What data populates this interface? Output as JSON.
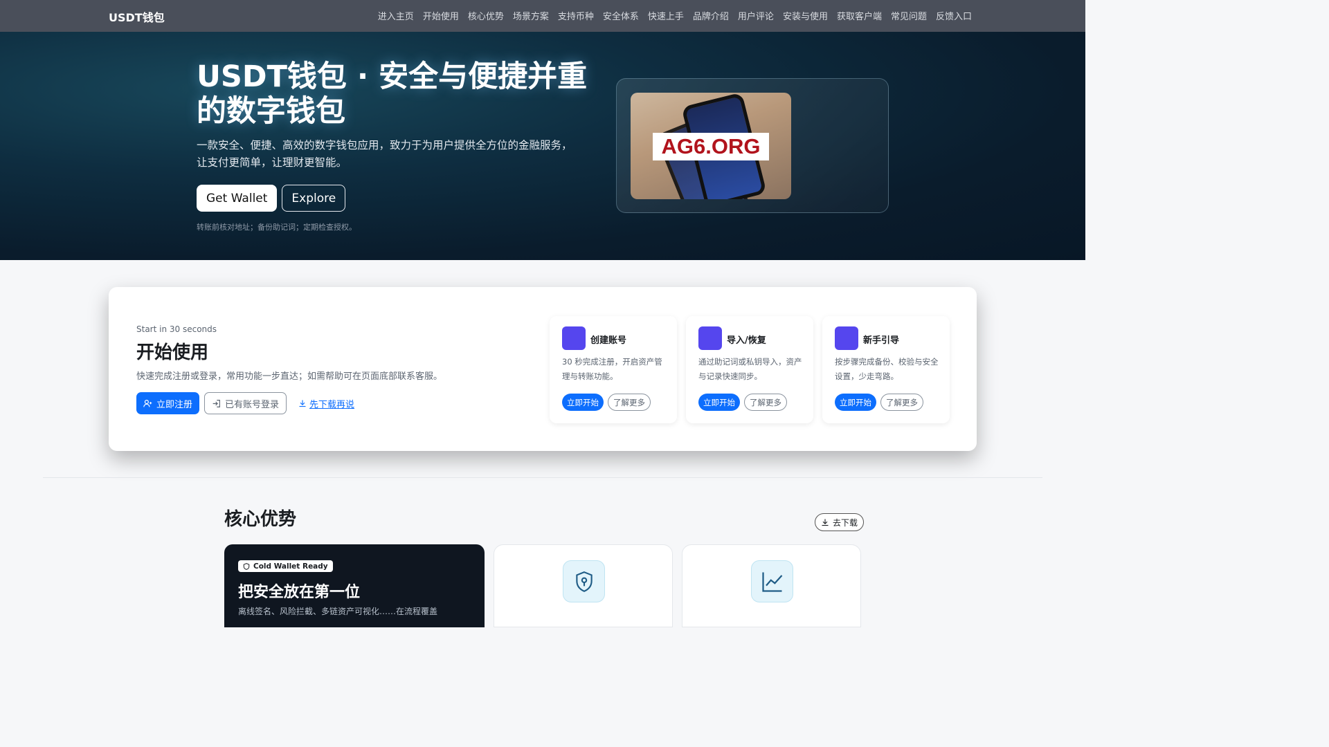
{
  "nav": {
    "brand": "USDT钱包",
    "links": [
      "进入主页",
      "开始使用",
      "核心优势",
      "场景方案",
      "支持币种",
      "安全体系",
      "快速上手",
      "品牌介绍",
      "用户评论",
      "安装与使用",
      "获取客户端",
      "常见问题",
      "反馈入口"
    ]
  },
  "hero": {
    "title": "USDT钱包 · 安全与便捷并重的数字钱包",
    "subtitle": "一款安全、便捷、高效的数字钱包应用，致力于为用户提供全方位的金融服务，让支付更简单，让理财更智能。",
    "btn_primary": "Get Wallet",
    "btn_secondary": "Explore",
    "note": "转账前核对地址；备份助记词；定期检查授权。",
    "image_label": "AG6.ORG"
  },
  "start": {
    "eyebrow": "Start in 30 seconds",
    "title": "开始使用",
    "desc": "快速完成注册或登录，常用功能一步直达；如需帮助可在页面底部联系客服。",
    "register": "立即注册",
    "login": "已有账号登录",
    "download_link": "先下载再说",
    "features": [
      {
        "title": "创建账号",
        "desc": "30 秒完成注册，开启资产管理与转账功能。",
        "btn_primary": "立即开始",
        "btn_secondary": "了解更多"
      },
      {
        "title": "导入/恢复",
        "desc": "通过助记词或私钥导入，资产与记录快速同步。",
        "btn_primary": "立即开始",
        "btn_secondary": "了解更多"
      },
      {
        "title": "新手引导",
        "desc": "按步骤完成备份、校验与安全设置，少走弯路。",
        "btn_primary": "立即开始",
        "btn_secondary": "了解更多"
      }
    ]
  },
  "advantages": {
    "title": "核心优势",
    "download_btn": "去下载",
    "dark_card": {
      "badge": "Cold Wallet Ready",
      "title": "把安全放在第一位",
      "text": "离线签名、风险拦截、多链资产可视化……在流程覆盖"
    },
    "cards": [
      {
        "icon": "shield-lock-icon"
      },
      {
        "icon": "chart-line-icon"
      }
    ]
  },
  "colors": {
    "navbar": "#4a4f5a",
    "primary": "#0d6efd",
    "feature_square": "#5546ee",
    "hero_bg": "#0e2d40"
  }
}
